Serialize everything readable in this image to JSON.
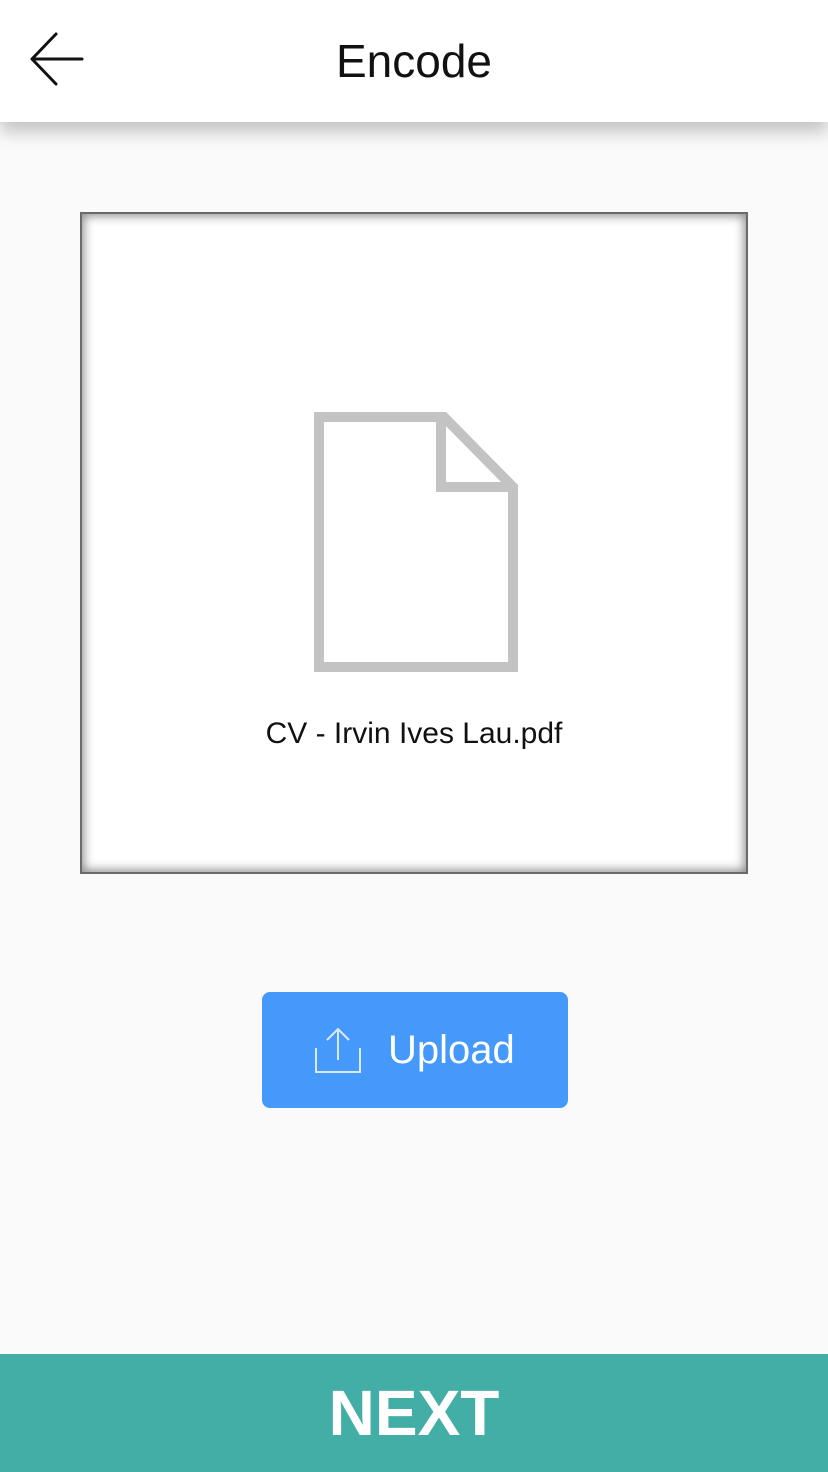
{
  "header": {
    "title": "Encode",
    "back_icon": "arrow-left-icon"
  },
  "preview": {
    "file_icon": "document-icon",
    "filename": "CV - Irvin Ives Lau.pdf"
  },
  "upload": {
    "label": "Upload",
    "icon": "upload-icon"
  },
  "footer": {
    "next_label": "NEXT"
  },
  "colors": {
    "upload_button": "#4499fa",
    "next_button": "#42aea6",
    "file_icon": "#c3c3c3"
  }
}
